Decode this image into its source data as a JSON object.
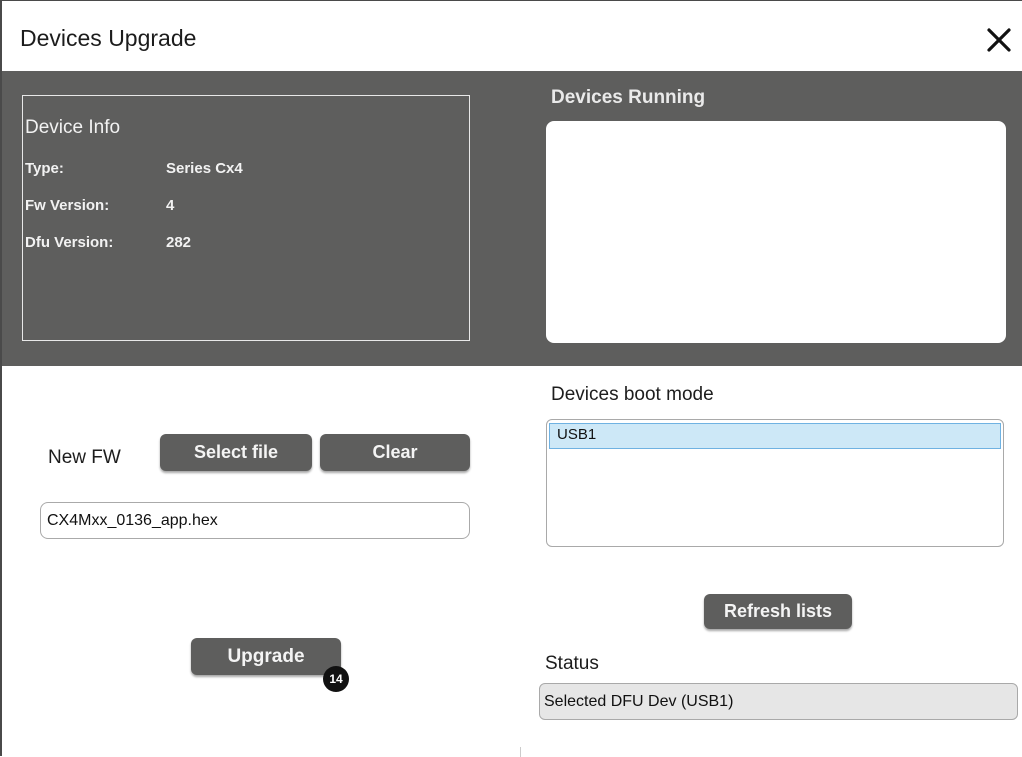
{
  "window": {
    "title": "Devices Upgrade"
  },
  "device_info": {
    "title": "Device Info",
    "rows": [
      {
        "label": "Type:",
        "value": "Series Cx4"
      },
      {
        "label": "Fw Version:",
        "value": "4"
      },
      {
        "label": "Dfu Version:",
        "value": "282"
      }
    ]
  },
  "devices_running": {
    "title": "Devices Running",
    "items": []
  },
  "new_fw": {
    "label": "New FW",
    "select_file_label": "Select file",
    "clear_label": "Clear",
    "filename": "CX4Mxx_0136_app.hex"
  },
  "boot_mode": {
    "title": "Devices boot mode",
    "items": [
      {
        "label": "USB1",
        "selected": true
      }
    ]
  },
  "actions": {
    "refresh_label": "Refresh lists",
    "upgrade_label": "Upgrade"
  },
  "status": {
    "label": "Status",
    "value": "Selected DFU Dev (USB1)"
  },
  "annotation": {
    "badge": "14"
  },
  "colors": {
    "panel": "#5e5e5d",
    "button": "#5e5e5d",
    "selection": "#cde8f7",
    "selection_border": "#6fb2e2"
  },
  "icons": {
    "close": "close-icon"
  }
}
